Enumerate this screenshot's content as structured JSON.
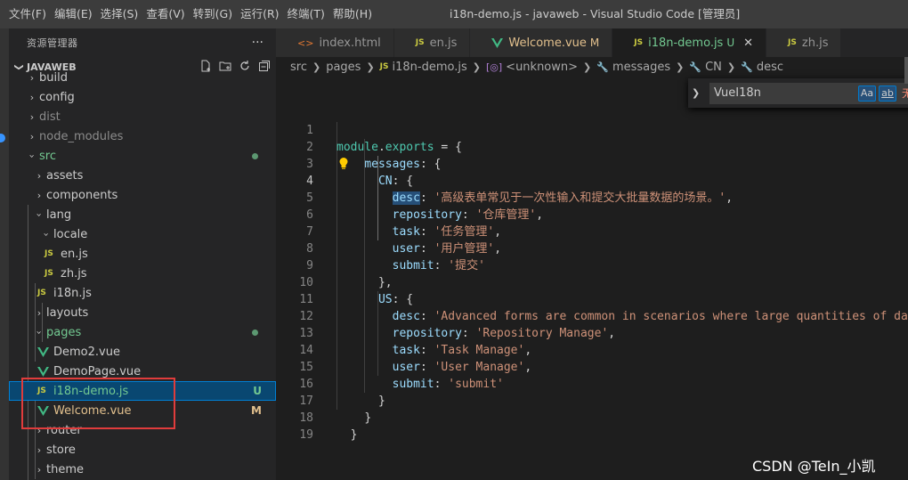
{
  "menu": [
    "文件(F)",
    "编辑(E)",
    "选择(S)",
    "查看(V)",
    "转到(G)",
    "运行(R)",
    "终端(T)",
    "帮助(H)"
  ],
  "window_title": "i18n-demo.js - javaweb - Visual Studio Code [管理员]",
  "sidebar": {
    "title": "资源管理器",
    "more": "···",
    "project": "JAVAWEB",
    "items": [
      {
        "label": "build",
        "type": "folder"
      },
      {
        "label": "config",
        "type": "folder"
      },
      {
        "label": "dist",
        "type": "folder"
      },
      {
        "label": "node_modules",
        "type": "folder"
      },
      {
        "label": "src",
        "type": "folder-open"
      },
      {
        "label": "assets",
        "type": "folder"
      },
      {
        "label": "components",
        "type": "folder"
      },
      {
        "label": "lang",
        "type": "folder-open"
      },
      {
        "label": "locale",
        "type": "folder-open"
      },
      {
        "label": "en.js",
        "type": "js"
      },
      {
        "label": "zh.js",
        "type": "js"
      },
      {
        "label": "i18n.js",
        "type": "js"
      },
      {
        "label": "layouts",
        "type": "folder"
      },
      {
        "label": "pages",
        "type": "folder-open"
      },
      {
        "label": "Demo2.vue",
        "type": "vue"
      },
      {
        "label": "DemoPage.vue",
        "type": "vue"
      },
      {
        "label": "i18n-demo.js",
        "type": "js",
        "status": "U"
      },
      {
        "label": "Welcome.vue",
        "type": "vue",
        "status": "M"
      },
      {
        "label": "router",
        "type": "folder"
      },
      {
        "label": "store",
        "type": "folder"
      },
      {
        "label": "theme",
        "type": "folder"
      }
    ]
  },
  "tabs": [
    {
      "label": "index.html",
      "icon": "html-icon"
    },
    {
      "label": "en.js",
      "icon": "js-icon"
    },
    {
      "label": "Welcome.vue",
      "icon": "vue-icon",
      "status": "M"
    },
    {
      "label": "i18n-demo.js",
      "icon": "js-icon",
      "status": "U",
      "active": true
    },
    {
      "label": "zh.js",
      "icon": "js-icon"
    }
  ],
  "js_icon_text": "JS",
  "html_icon_text": "<>",
  "breadcrumb": [
    "src",
    "pages",
    "i18n-demo.js",
    "<unknown>",
    "messages",
    "CN",
    "desc"
  ],
  "find": {
    "query": "VueI18n",
    "case": "Aa",
    "word": "ab",
    "regex": ".*",
    "more": "无"
  },
  "code_lines": [
    "1",
    "2",
    "3",
    "4",
    "5",
    "6",
    "7",
    "8",
    "9",
    "10",
    "11",
    "12",
    "13",
    "14",
    "15",
    "16",
    "17",
    "18",
    "19"
  ],
  "code": {
    "l1a": "module",
    "l1b": ".",
    "l1c": "exports",
    "l1d": " = {",
    "l2": "messages",
    "colon": ":",
    "brace_open": " {",
    "l3": "CN",
    "desc": "desc",
    "desc_cn": "'高级表单常见于一次性输入和提交大批量数据的场景。'",
    "repository": "repository",
    "repo_cn": "'仓库管理'",
    "task": "task",
    "task_cn": "'任务管理'",
    "user": "user",
    "user_cn": "'用户管理'",
    "submit": "submit",
    "submit_cn": "'提交'",
    "close_comma": "},",
    "us": "US",
    "desc_us": "'Advanced forms are common in scenarios where large quantities of data",
    "repo_us": "'Repository Manage'",
    "task_us": "'Task Manage'",
    "user_us": "'User Manage'",
    "submit_us": "'submit'",
    "close": "}",
    "comma": ","
  },
  "watermark": "CSDN @TeIn_小凯",
  "colors": {
    "accent": "#007fd4",
    "selection": "#094771",
    "untracked": "#73c991",
    "modified": "#e2c08d",
    "highlight_box": "#e03c3c"
  }
}
